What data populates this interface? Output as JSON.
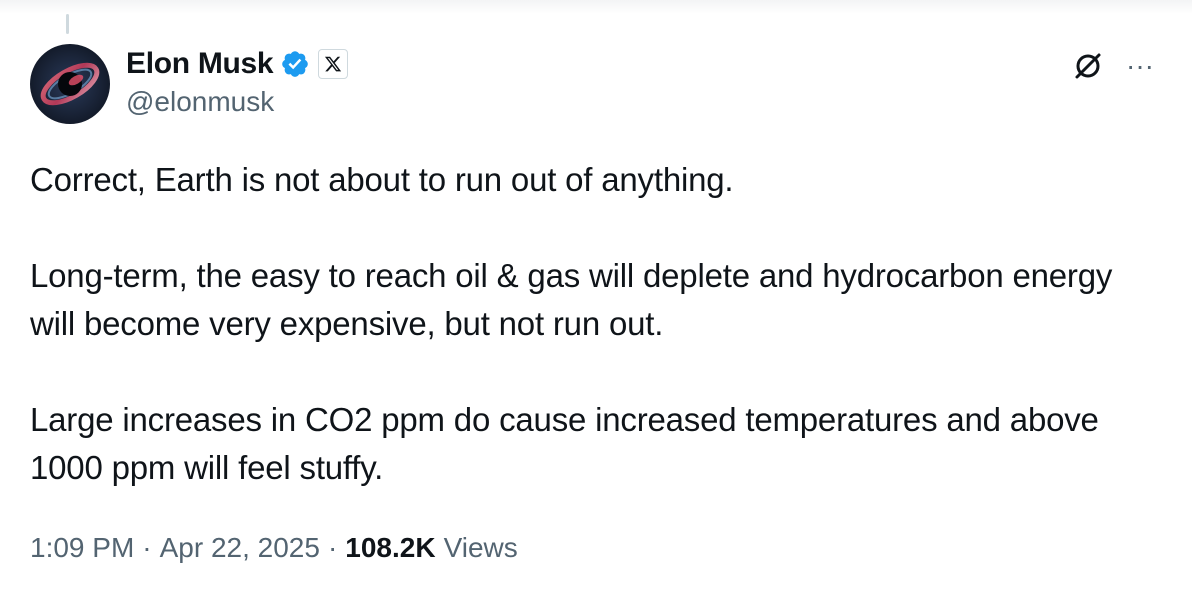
{
  "author": {
    "display_name": "Elon Musk",
    "handle": "@elonmusk",
    "verified": true,
    "affiliate_icon": "x-logo-icon",
    "avatar_icon": "avatar-image"
  },
  "tweet": {
    "paragraphs": [
      "Correct, Earth is not about to run out of anything.",
      "Long-term, the easy to reach oil & gas will deplete and hydrocarbon energy will become very expensive, but not run out.",
      "Large increases in CO2 ppm do cause increased temperatures and above 1000 ppm will feel stuffy."
    ]
  },
  "meta": {
    "time": "1:09 PM",
    "separator": "·",
    "date": "Apr 22, 2025",
    "views_count": "108.2K",
    "views_label": "Views"
  },
  "actions": {
    "grok_icon": "grok-icon",
    "more_icon": "more-icon",
    "more_label": "···"
  },
  "colors": {
    "text_primary": "#0f1419",
    "text_secondary": "#536471",
    "verified_blue": "#1d9bf0",
    "background": "#ffffff"
  }
}
